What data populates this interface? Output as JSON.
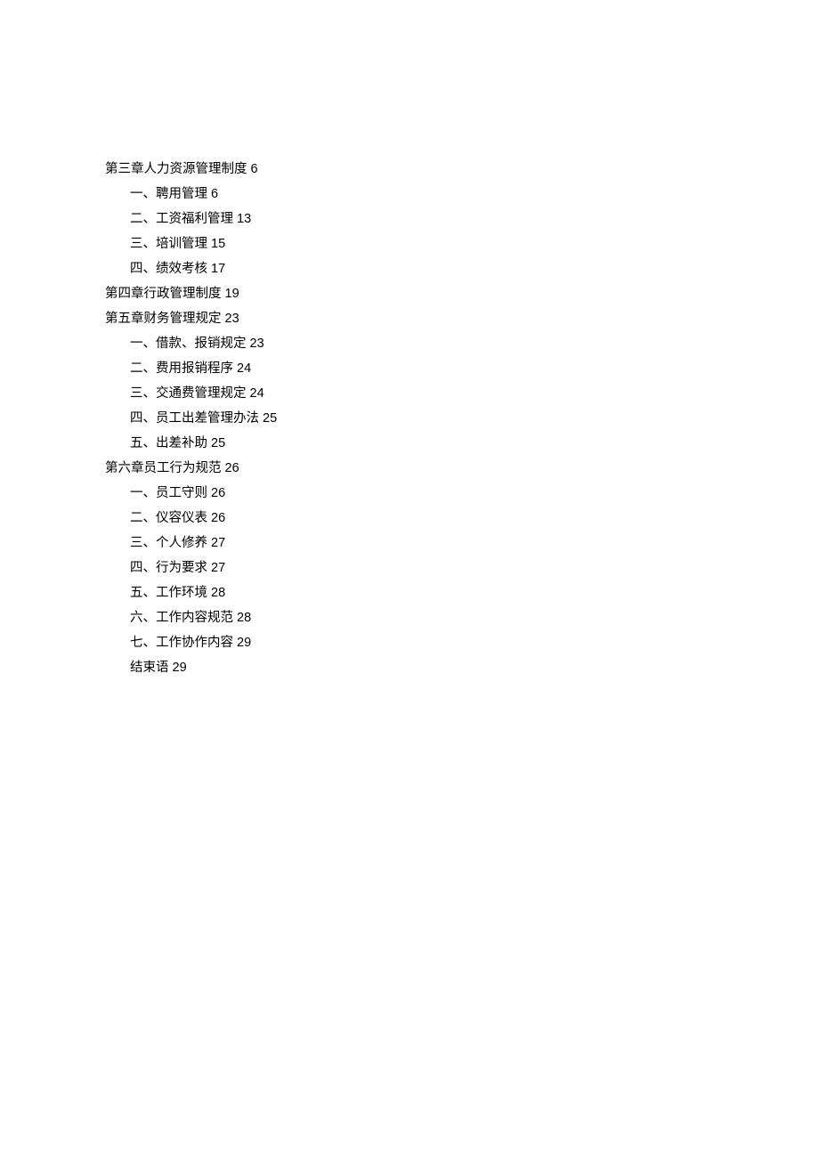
{
  "toc": [
    {
      "indent": false,
      "label": "第三章人力资源管理制度",
      "page": "6"
    },
    {
      "indent": true,
      "label": "一、聘用管理",
      "page": "6"
    },
    {
      "indent": true,
      "label": "二、工资福利管理",
      "page": "13"
    },
    {
      "indent": true,
      "label": "三、培训管理",
      "page": "15"
    },
    {
      "indent": true,
      "label": "四、绩效考核",
      "page": "17"
    },
    {
      "indent": false,
      "label": "第四章行政管理制度",
      "page": "19"
    },
    {
      "indent": false,
      "label": "第五章财务管理规定",
      "page": "23"
    },
    {
      "indent": true,
      "label": "一、借款、报销规定",
      "page": "23"
    },
    {
      "indent": true,
      "label": "二、费用报销程序",
      "page": "24"
    },
    {
      "indent": true,
      "label": "三、交通费管理规定",
      "page": "24"
    },
    {
      "indent": true,
      "label": "四、员工出差管理办法",
      "page": "25"
    },
    {
      "indent": true,
      "label": "五、出差补助",
      "page": "25"
    },
    {
      "indent": false,
      "label": "第六章员工行为规范",
      "page": "26"
    },
    {
      "indent": true,
      "label": "一、员工守则",
      "page": "26"
    },
    {
      "indent": true,
      "label": "二、仪容仪表",
      "page": "26"
    },
    {
      "indent": true,
      "label": "三、个人修养",
      "page": "27"
    },
    {
      "indent": true,
      "label": "四、行为要求",
      "page": "27"
    },
    {
      "indent": true,
      "label": "五、工作环境",
      "page": "28"
    },
    {
      "indent": true,
      "label": "六、工作内容规范",
      "page": "28"
    },
    {
      "indent": true,
      "label": "七、工作协作内容",
      "page": "29"
    },
    {
      "indent": true,
      "label": "结束语",
      "page": "29"
    }
  ]
}
